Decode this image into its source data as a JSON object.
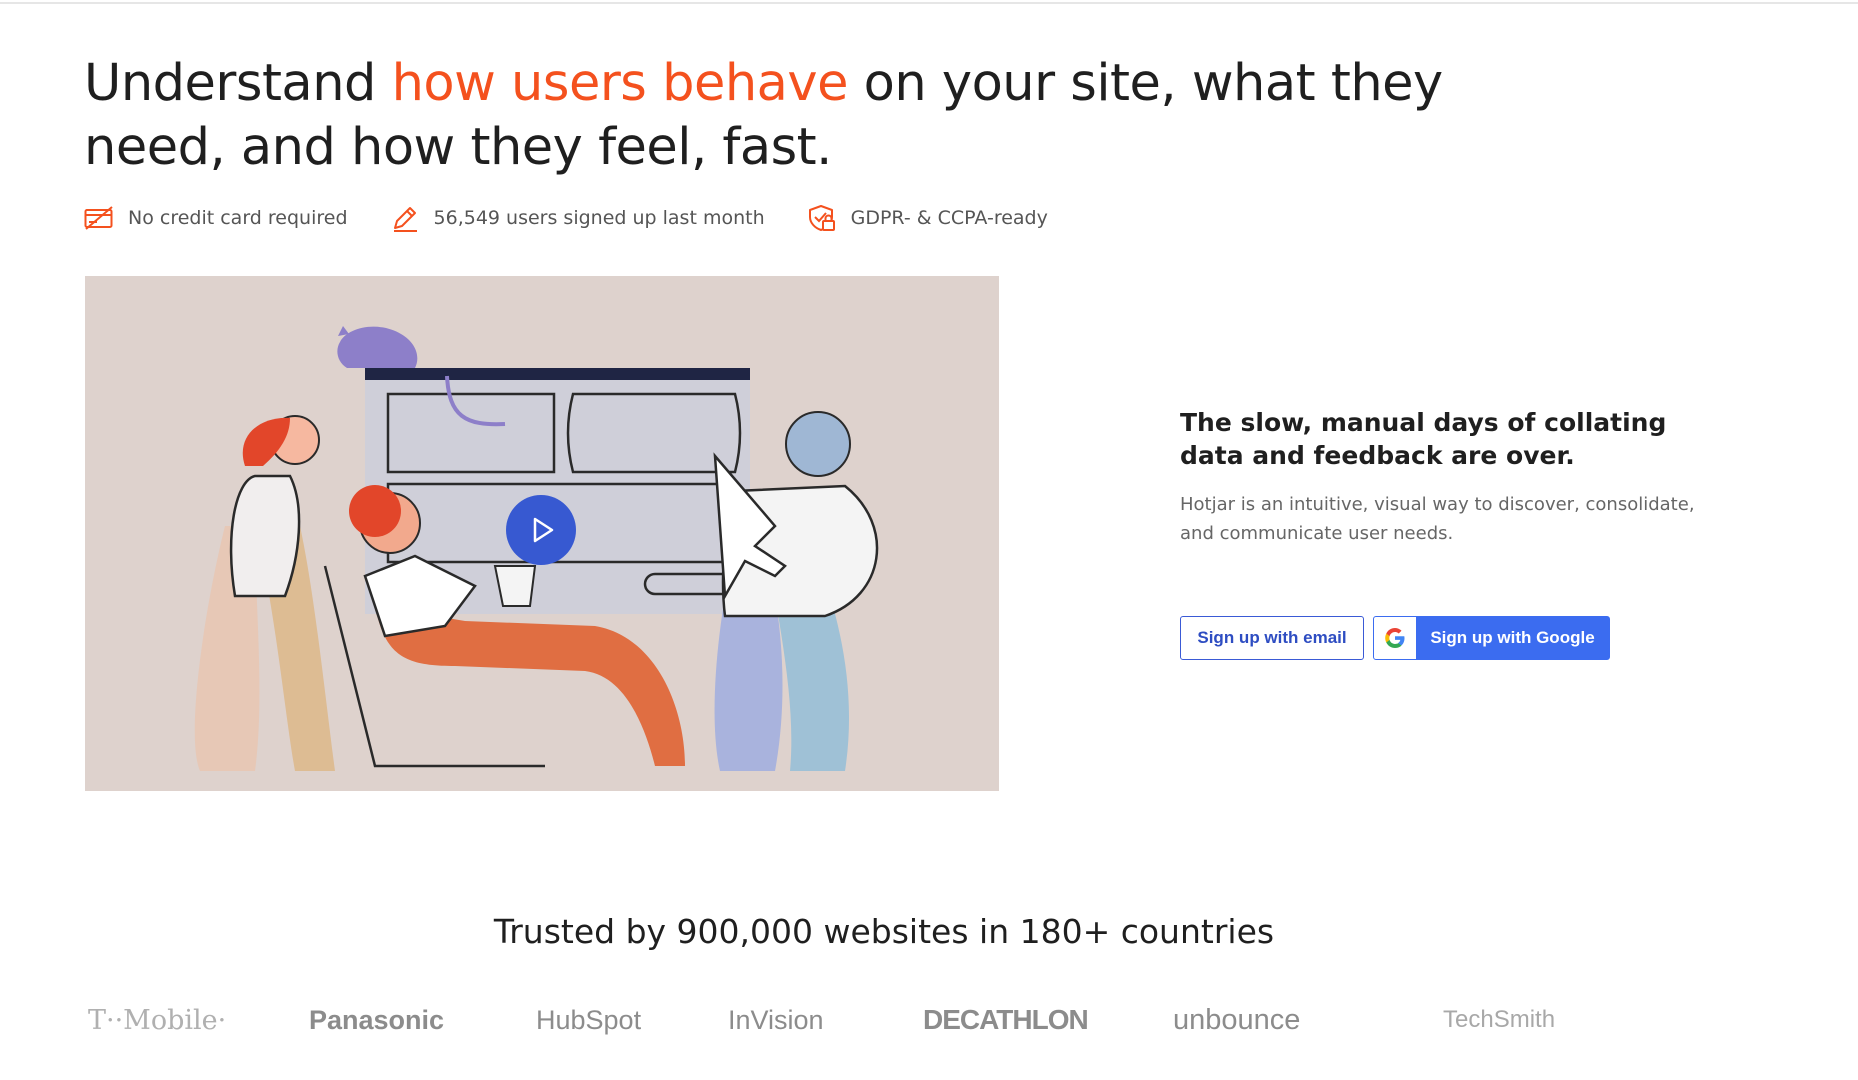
{
  "hero": {
    "title_part1": "Understand ",
    "title_accent": "how users behave",
    "title_part2": " on your site, what they need, and how they feel, fast.",
    "accent_color": "#f4511e"
  },
  "features": [
    {
      "icon": "credit-card-icon",
      "label": "No credit card required"
    },
    {
      "icon": "pencil-icon",
      "label": "56,549 users signed up last month"
    },
    {
      "icon": "shield-lock-icon",
      "label": "GDPR- & CCPA-ready"
    }
  ],
  "video": {
    "icon": "play-icon"
  },
  "cta": {
    "title": "The slow, manual days of collating data and feedback are over.",
    "text": "Hotjar is an intuitive, visual way to discover, consolidate, and communicate user needs.",
    "email_button": "Sign up with email",
    "google_button": "Sign up with Google",
    "google_icon": "google-icon",
    "brand_color": "#3b6cf0"
  },
  "trusted": {
    "heading": "Trusted by 900,000 websites in 180+ countries",
    "logos": [
      "T··Mobile·",
      "Panasonic",
      "HubSpot",
      "InVision",
      "DECATHLON",
      "unbounce",
      "TechSmith"
    ]
  }
}
